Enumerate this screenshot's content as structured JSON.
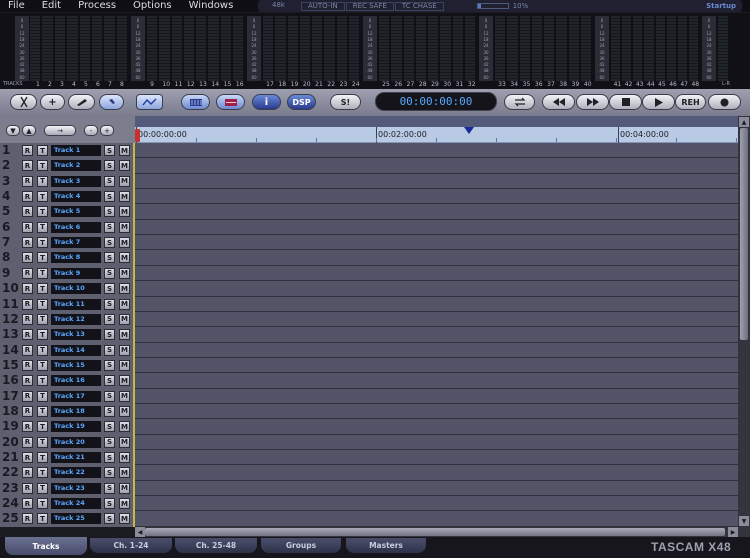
{
  "menu": [
    "File",
    "Edit",
    "Process",
    "Options",
    "Windows"
  ],
  "status": {
    "sample_rate": "48k",
    "auto_in": "AUTO-IN",
    "rec_safe": "REC SAFE",
    "tc_chase": "TC CHASE",
    "cpu_level": 0.1,
    "cpu_percent": "10%",
    "profile": "Startup"
  },
  "meters": {
    "caption": "TRACKS",
    "lr_caption": "L-R",
    "scale_marks": [
      "0",
      "6",
      "12",
      "18",
      "24",
      "30",
      "36",
      "42",
      "48",
      "60"
    ],
    "channel_labels": [
      "1",
      "2",
      "3",
      "4",
      "5",
      "6",
      "7",
      "8",
      "9",
      "10",
      "11",
      "12",
      "13",
      "14",
      "15",
      "16",
      "17",
      "18",
      "19",
      "20",
      "21",
      "22",
      "23",
      "24",
      "25",
      "26",
      "27",
      "28",
      "29",
      "30",
      "31",
      "32",
      "33",
      "34",
      "35",
      "36",
      "37",
      "38",
      "39",
      "40",
      "41",
      "42",
      "43",
      "44",
      "45",
      "46",
      "47",
      "48"
    ]
  },
  "toolbar": {
    "cut_icon": "scissors-icon",
    "add_label": "+",
    "pencil_icon": "pencil-icon",
    "hand_icon": "hand-icon",
    "auto_icon": "automation-icon",
    "mixer_icon": "mixer-icon",
    "record_icon": "record-panel-icon",
    "info_label": "i",
    "dsp_label": "DSP",
    "solo_clear_label": "S!",
    "timecode": "00:00:00:00",
    "loop_icon": "loop-icon",
    "rew_icon": "rewind-icon",
    "ff_icon": "fast-forward-icon",
    "stop_icon": "stop-icon",
    "play_icon": "play-icon",
    "reh_label": "REH",
    "rec_icon": "record-icon"
  },
  "track_header": {
    "collapse_label": "▼",
    "expand_label": "▲",
    "arrow_label": "→",
    "minus_label": "-",
    "plus_label": "+"
  },
  "ruler": {
    "marks": [
      "00:00:00:00",
      "00:02:00:00",
      "00:04:00:00"
    ]
  },
  "track_buttons": {
    "rec": "R",
    "track": "T",
    "solo": "S",
    "mute": "M"
  },
  "tracks": [
    {
      "num": "1",
      "name": "Track 1"
    },
    {
      "num": "2",
      "name": "Track 2"
    },
    {
      "num": "3",
      "name": "Track 3"
    },
    {
      "num": "4",
      "name": "Track 4"
    },
    {
      "num": "5",
      "name": "Track 5"
    },
    {
      "num": "6",
      "name": "Track 6"
    },
    {
      "num": "7",
      "name": "Track 7"
    },
    {
      "num": "8",
      "name": "Track 8"
    },
    {
      "num": "9",
      "name": "Track 9"
    },
    {
      "num": "10",
      "name": "Track 10"
    },
    {
      "num": "11",
      "name": "Track 11"
    },
    {
      "num": "12",
      "name": "Track 12"
    },
    {
      "num": "13",
      "name": "Track 13"
    },
    {
      "num": "14",
      "name": "Track 14"
    },
    {
      "num": "15",
      "name": "Track 15"
    },
    {
      "num": "16",
      "name": "Track 16"
    },
    {
      "num": "17",
      "name": "Track 17"
    },
    {
      "num": "18",
      "name": "Track 18"
    },
    {
      "num": "19",
      "name": "Track 19"
    },
    {
      "num": "20",
      "name": "Track 20"
    },
    {
      "num": "21",
      "name": "Track 21"
    },
    {
      "num": "22",
      "name": "Track 22"
    },
    {
      "num": "23",
      "name": "Track 23"
    },
    {
      "num": "24",
      "name": "Track 24"
    },
    {
      "num": "25",
      "name": "Track 25"
    }
  ],
  "tabs": [
    "Tracks",
    "Ch. 1-24",
    "Ch. 25-48",
    "Groups",
    "Masters"
  ],
  "active_tab": "Tracks",
  "brand": "TASCAM X48"
}
